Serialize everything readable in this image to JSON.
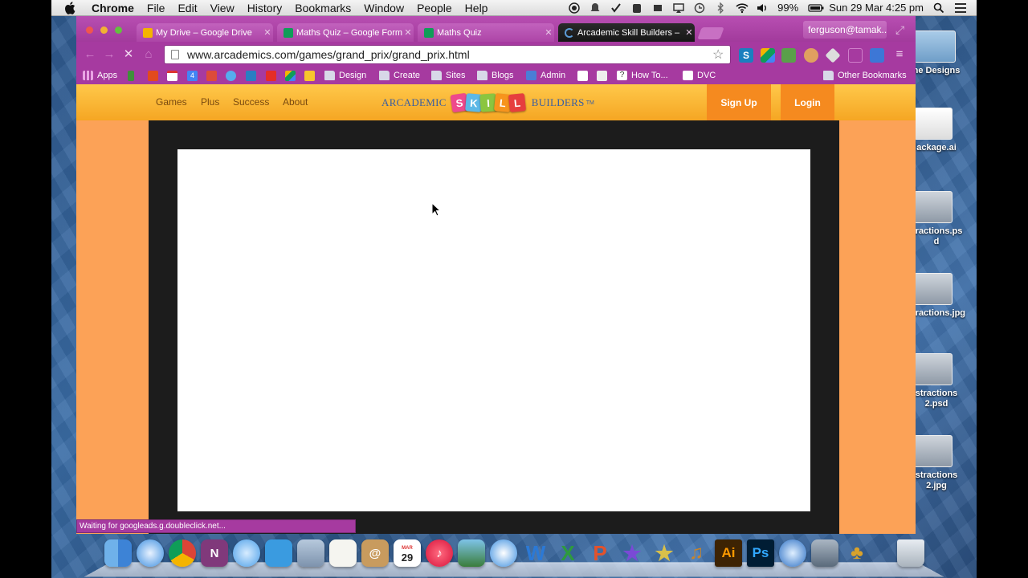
{
  "menubar": {
    "app_name": "Chrome",
    "items": [
      "File",
      "Edit",
      "View",
      "History",
      "Bookmarks",
      "Window",
      "People",
      "Help"
    ],
    "battery": "99%",
    "clock": "Sun 29 Mar  4:25 pm"
  },
  "browser": {
    "tabs": [
      {
        "title": "My Drive – Google Drive",
        "favicon_color": "#f4b400"
      },
      {
        "title": "Maths Quiz – Google Form",
        "favicon_color": "#0f9d58"
      },
      {
        "title": "Maths Quiz",
        "favicon_color": "#0f9d58"
      },
      {
        "title": "Arcademic Skill Builders –",
        "favicon_color": "#5b9bd5"
      }
    ],
    "profile": "ferguson@tamak...",
    "url": "www.arcademics.com/games/grand_prix/grand_prix.html",
    "status_text": "Waiting for googleads.g.doubleclick.net...",
    "bookmarks": {
      "apps": "Apps",
      "design": "Design",
      "create": "Create",
      "sites": "Sites",
      "blogs": "Blogs",
      "admin": "Admin",
      "howto": "How To...",
      "dvc": "DVC",
      "other": "Other Bookmarks",
      "calendar_number": "4"
    }
  },
  "site": {
    "nav": [
      "Games",
      "Plus",
      "Success",
      "About"
    ],
    "logo_left": "ARCADEMIC",
    "logo_tiles": [
      "S",
      "K",
      "I",
      "L",
      "L"
    ],
    "logo_right": "BUILDERS",
    "logo_tm": "TM",
    "signup": "Sign Up",
    "login": "Login"
  },
  "desktop_icons": [
    "ne Designs",
    "ackage.ai",
    "tractions.ps d",
    "tractions.jpg",
    "stractions 2.psd",
    "stractions 2.jpg"
  ],
  "dock": {
    "calendar_day": "29",
    "calendar_month": "MAR"
  },
  "colors": {
    "chrome_theme": "#a63aa0",
    "site_header": "#f5a623",
    "site_side": "#fca257",
    "button_orange": "#f58a1f"
  }
}
